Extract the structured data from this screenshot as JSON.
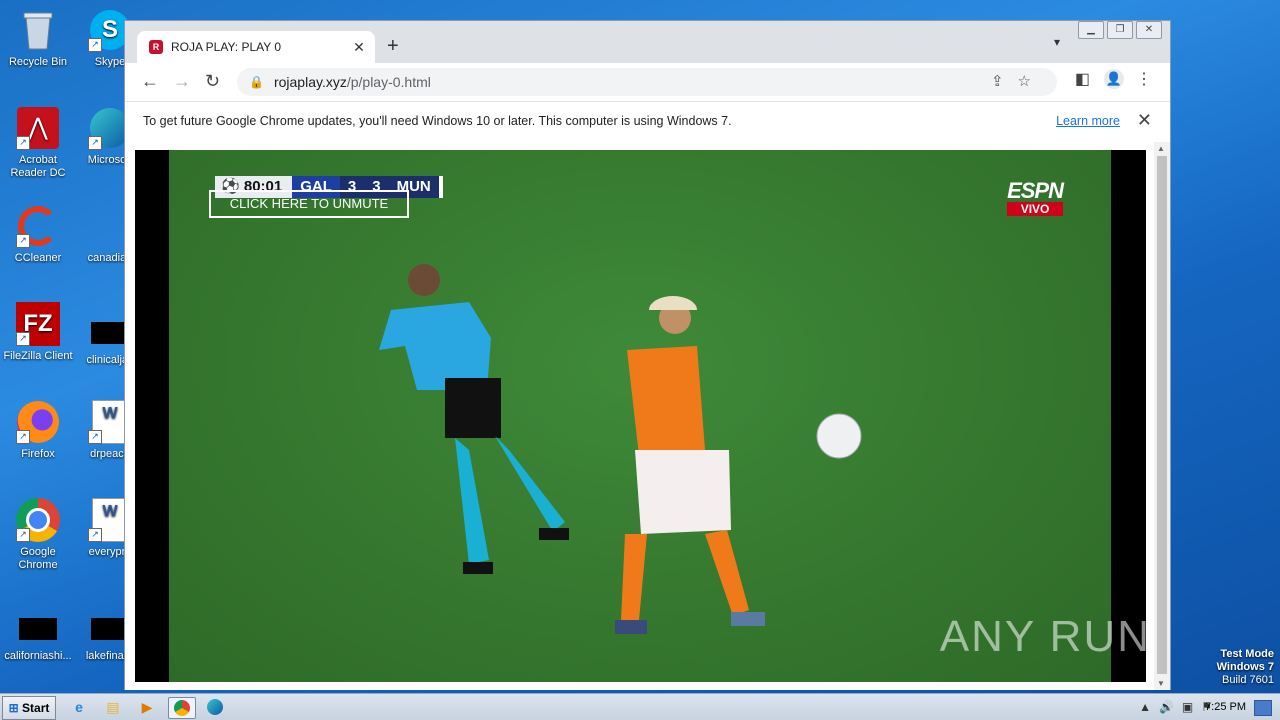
{
  "desktop": {
    "icons": [
      {
        "label": "Recycle Bin",
        "icon": "recycle-bin-icon"
      },
      {
        "label": "Skype",
        "icon": "skype-icon"
      },
      {
        "label": "Acrobat Reader DC",
        "icon": "acrobat-icon"
      },
      {
        "label": "Microsoft",
        "icon": "edge-icon"
      },
      {
        "label": "CCleaner",
        "icon": "ccleaner-icon"
      },
      {
        "label": "canadian",
        "icon": "file-icon"
      },
      {
        "label": "FileZilla Client",
        "icon": "filezilla-icon"
      },
      {
        "label": "clinicaljac",
        "icon": "file-icon"
      },
      {
        "label": "Firefox",
        "icon": "firefox-icon"
      },
      {
        "label": "drpeace",
        "icon": "word-icon"
      },
      {
        "label": "Google Chrome",
        "icon": "chrome-icon"
      },
      {
        "label": "everypre",
        "icon": "word-icon"
      },
      {
        "label": "californiashi...",
        "icon": "file-icon"
      },
      {
        "label": "lakefinally",
        "icon": "file-icon"
      }
    ],
    "watermark": {
      "line1": "Test Mode",
      "line2": "Windows 7",
      "line3": "Build 7601"
    }
  },
  "browser": {
    "tab_title": "ROJA PLAY: PLAY 0",
    "url_domain": "rojaplay.xyz",
    "url_path": "/p/play-0.html",
    "infobar_message": "To get future Google Chrome updates, you'll need Windows 10 or later. This computer is using Windows 7.",
    "infobar_link": "Learn more"
  },
  "player": {
    "clock": "80:01",
    "home_team": "GAL",
    "home_score": "3",
    "away_score": "3",
    "away_team": "MUN",
    "unmute_label": "CLICK HERE TO UNMUTE",
    "broadcaster": "ESPN",
    "live_label": "VIVO",
    "overlay_watermark": "ANY RUN"
  },
  "taskbar": {
    "start_label": "Start",
    "time": "7:25 PM"
  }
}
